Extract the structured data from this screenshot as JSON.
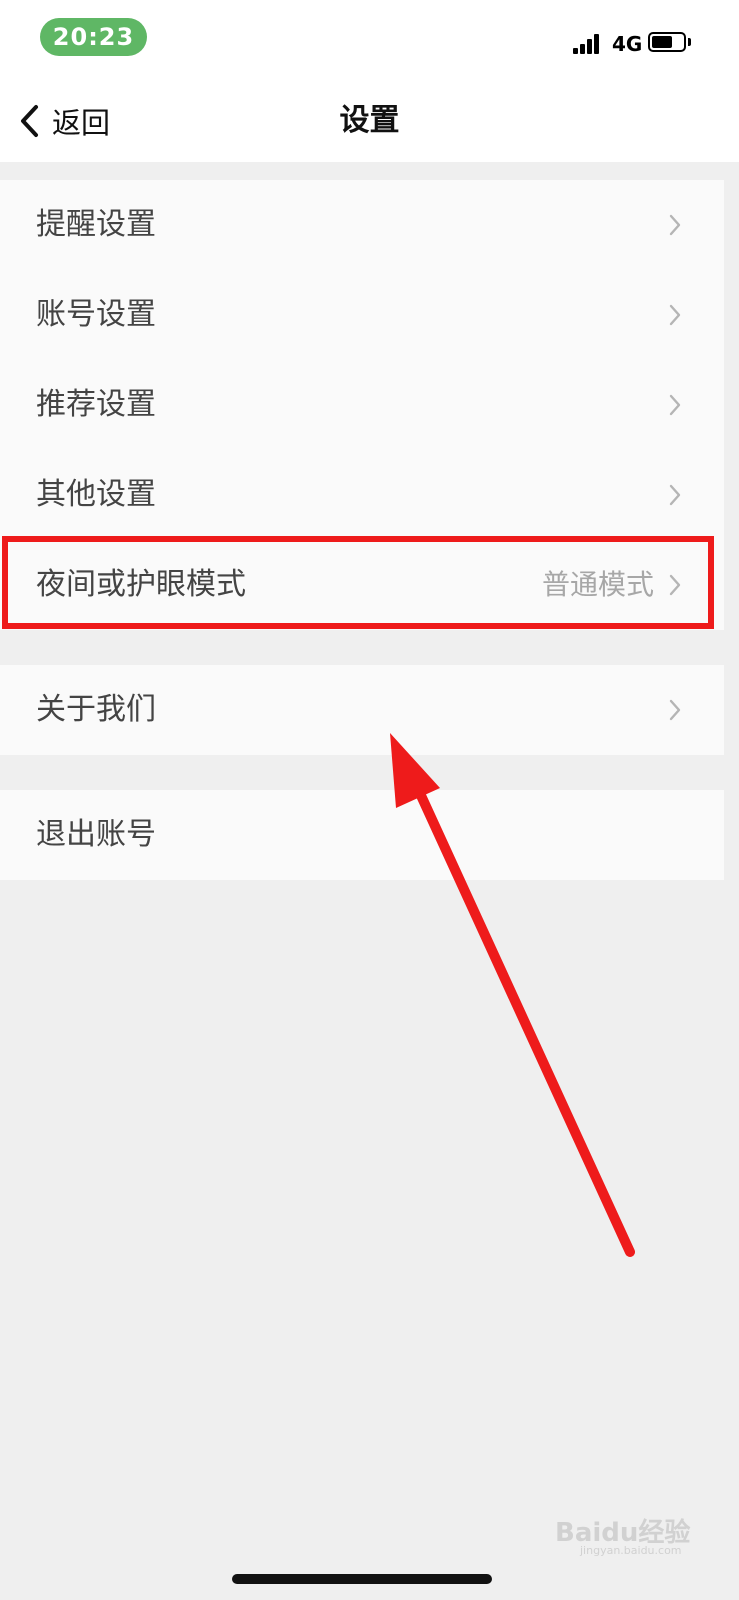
{
  "status_bar": {
    "time": "20:23",
    "network": "4G",
    "icons": [
      "signal-icon",
      "battery-icon"
    ],
    "battery_level": 0.6,
    "time_pill_color": "#5fb765"
  },
  "nav": {
    "back_label": "返回",
    "title": "设置"
  },
  "settings_group": [
    {
      "label": "提醒设置"
    },
    {
      "label": "账号设置"
    },
    {
      "label": "推荐设置"
    },
    {
      "label": "其他设置"
    },
    {
      "label": "夜间或护眼模式",
      "value": "普通模式"
    }
  ],
  "about_group": [
    {
      "label": "关于我们"
    }
  ],
  "logout_group": [
    {
      "label": "退出账号"
    }
  ],
  "annotation": {
    "highlight_color": "#ee1b1b",
    "arrow_color": "#ee1b1b"
  },
  "watermark": {
    "text": "Baidu经验",
    "sub": "jingyan.baidu.com"
  }
}
